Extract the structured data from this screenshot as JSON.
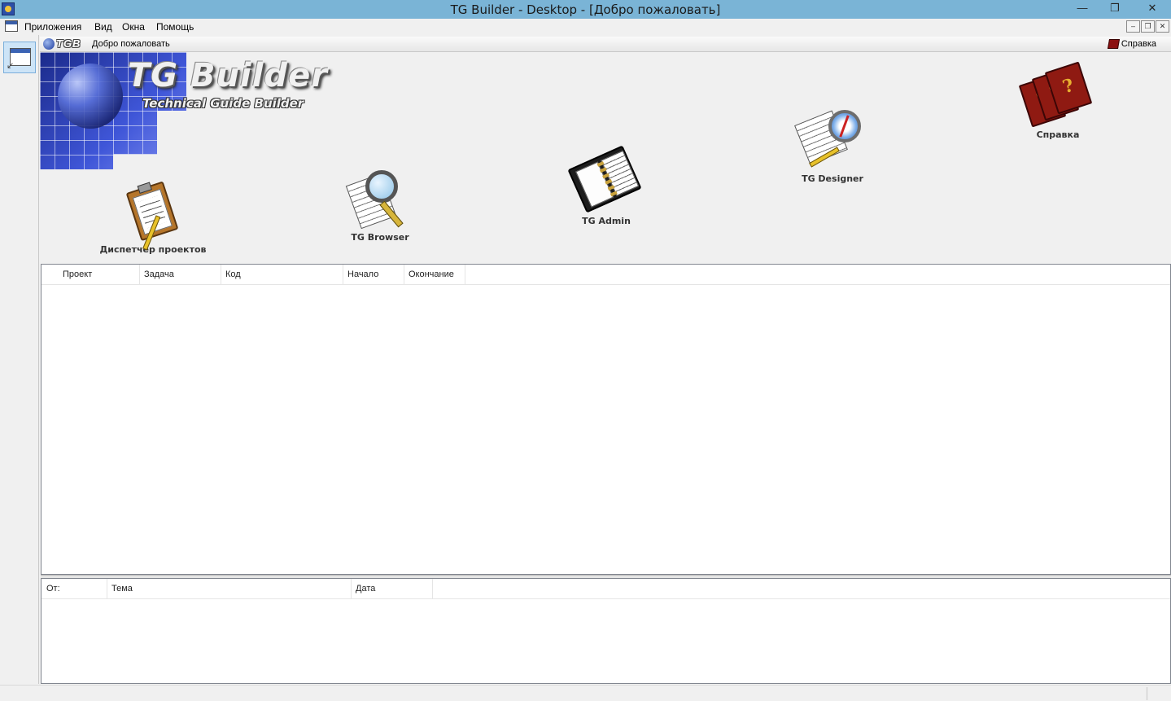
{
  "window": {
    "title": "TG Builder - Desktop - [Добро пожаловать]",
    "minimize_glyph": "—",
    "restore_glyph": "❐",
    "close_glyph": "✕"
  },
  "menu": {
    "items": [
      "Приложения",
      "Вид",
      "Окна",
      "Помощь"
    ],
    "mdi_min": "–",
    "mdi_restore": "❐",
    "mdi_close": "✕"
  },
  "child": {
    "logo_text": "TGB",
    "caption": "Добро пожаловать",
    "help_link": "Справка"
  },
  "banner": {
    "title": "TG Builder",
    "subtitle": "Technical Guide Builder"
  },
  "launchers": [
    {
      "label": "Диспетчер проектов",
      "icon": "clipboard-icon"
    },
    {
      "label": "TG Browser",
      "icon": "magnifier-icon"
    },
    {
      "label": "TG Admin",
      "icon": "binder-icon"
    },
    {
      "label": "TG Designer",
      "icon": "compass-icon"
    },
    {
      "label": "Справка",
      "icon": "help-books-icon"
    }
  ],
  "projects_table": {
    "columns": [
      "Проект",
      "Задача",
      "Код",
      "Начало",
      "Окончание"
    ],
    "rows": []
  },
  "messages_table": {
    "columns": [
      "От:",
      "Тема",
      "Дата"
    ],
    "rows": []
  },
  "colors": {
    "titlebar": "#7ab4d6",
    "selected_tool": "#cde4f7"
  }
}
